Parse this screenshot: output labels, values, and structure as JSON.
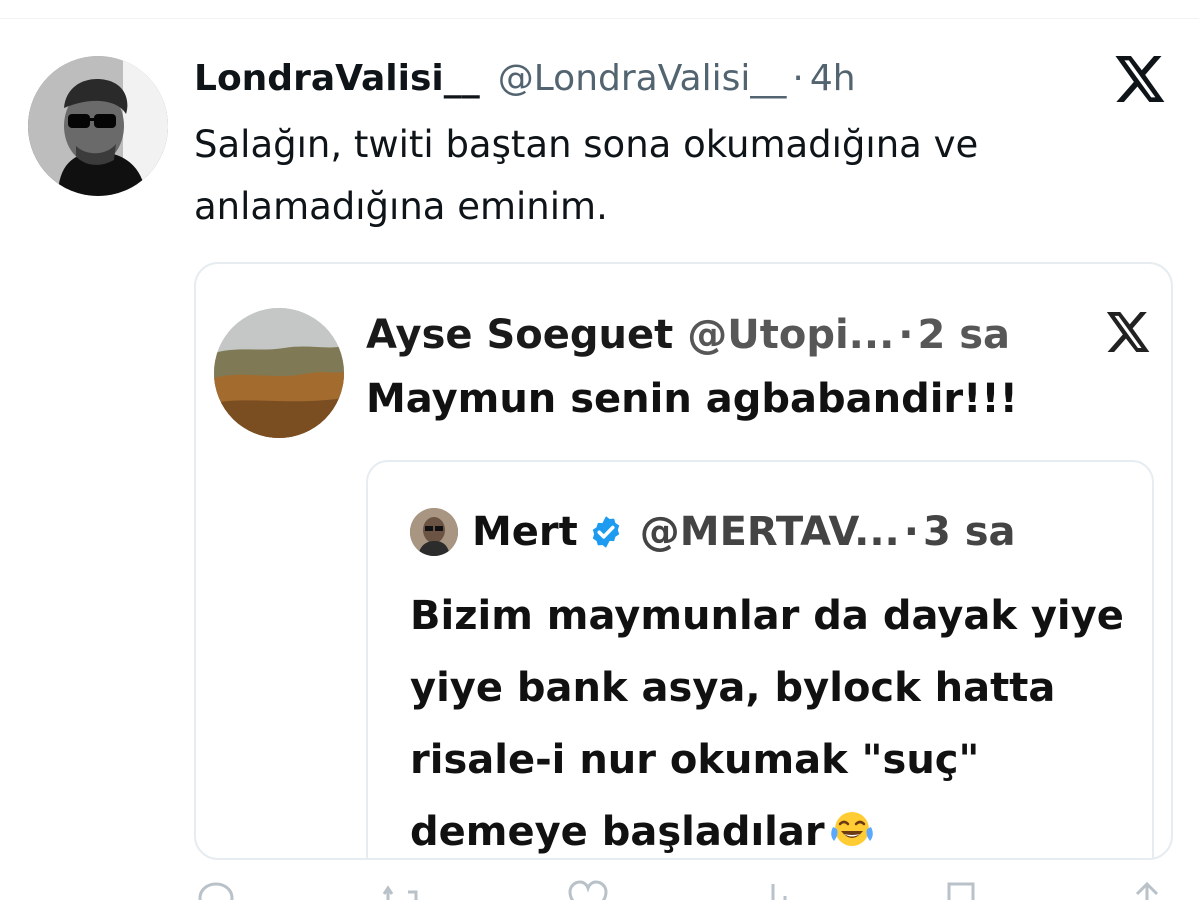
{
  "tweet": {
    "author_name": "LondraValisi__",
    "author_handle": "@LondraValisi__",
    "separator": "·",
    "time": "4h",
    "text": "Salağın, twiti baştan sona okumadığına ve anlamadığına eminim.",
    "avatar_icon": "profile-photo"
  },
  "quoted_tweet": {
    "author_name": "Ayse Soeguet",
    "author_handle": "@Utopi...",
    "separator": "·",
    "time": "2 sa",
    "text": "Maymun senin agbabandir!!!",
    "avatar_icon": "forest-photo"
  },
  "nested_quote": {
    "author_name": "Mert",
    "author_handle": "@MERTAV...",
    "separator": "·",
    "time": "3 sa",
    "text": "Bizim maymunlar da dayak yiye yiye bank asya, bylock hatta risale-i nur okumak \"suç\" demeye başladılar",
    "verified_icon": "verified-badge-icon",
    "emoji_icon": "tears-of-joy-emoji",
    "colors": {
      "verified": "#1d9bf0"
    }
  },
  "actions": [
    {
      "icon": "reply-icon"
    },
    {
      "icon": "retweet-icon"
    },
    {
      "icon": "like-icon"
    },
    {
      "icon": "views-icon"
    },
    {
      "icon": "bookmark-icon"
    },
    {
      "icon": "share-icon"
    }
  ],
  "colors": {
    "text_primary": "#0f1419",
    "text_secondary": "#536471",
    "border": "#e6ecf0"
  }
}
